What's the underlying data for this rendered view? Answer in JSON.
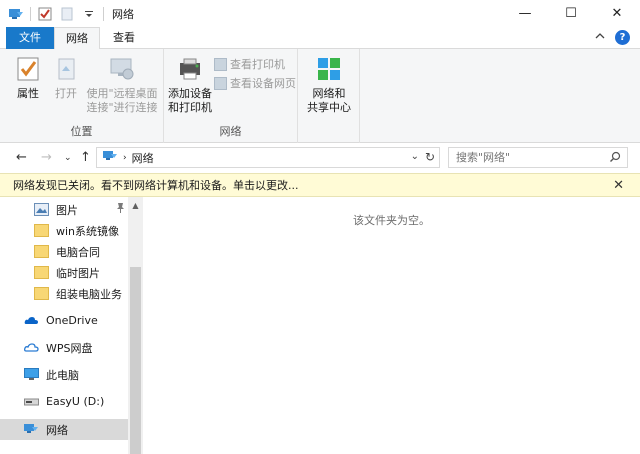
{
  "window": {
    "title": "网络",
    "controls": {
      "minimize": "—",
      "maximize": "☐",
      "close": "✕"
    }
  },
  "tabs": [
    {
      "label": "文件"
    },
    {
      "label": "网络"
    },
    {
      "label": "查看"
    }
  ],
  "ribbon": {
    "groups": [
      {
        "label": "位置",
        "buttons": [
          {
            "label": "属性",
            "enabled": true,
            "icon": "properties-icon"
          },
          {
            "label": "打开",
            "enabled": false,
            "icon": "open-icon"
          },
          {
            "label_line1": "使用\"远程桌面",
            "label_line2": "连接\"进行连接",
            "enabled": false,
            "icon": "remote-desktop-icon"
          }
        ]
      },
      {
        "label": "网络",
        "buttons": [
          {
            "label_line1": "添加设备",
            "label_line2": "和打印机",
            "enabled": true,
            "icon": "add-device-icon"
          },
          {
            "label": "查看打印机",
            "enabled": false,
            "icon": "view-printers-icon"
          },
          {
            "label": "查看设备网页",
            "enabled": false,
            "icon": "view-device-webpage-icon"
          }
        ]
      },
      {
        "label": "",
        "buttons": [
          {
            "label_line1": "网络和",
            "label_line2": "共享中心",
            "enabled": true,
            "icon": "network-sharing-center-icon"
          }
        ]
      }
    ]
  },
  "address_bar": {
    "breadcrumb": [
      "网络"
    ],
    "search_placeholder": "搜索\"网络\""
  },
  "info_bar": {
    "message": "网络发现已关闭。看不到网络计算机和设备。单击以更改..."
  },
  "nav_pane": {
    "items": [
      {
        "label": "图片",
        "icon": "pictures-icon",
        "pinned": true
      },
      {
        "label": "win系统镜像",
        "icon": "folder-icon"
      },
      {
        "label": "电脑合同",
        "icon": "folder-icon"
      },
      {
        "label": "临时图片",
        "icon": "folder-icon"
      },
      {
        "label": "组装电脑业务",
        "icon": "folder-icon"
      },
      {
        "label": "OneDrive",
        "icon": "onedrive-icon"
      },
      {
        "label": "WPS网盘",
        "icon": "wps-cloud-icon"
      },
      {
        "label": "此电脑",
        "icon": "this-pc-icon"
      },
      {
        "label": "EasyU (D:)",
        "icon": "drive-icon"
      },
      {
        "label": "网络",
        "icon": "network-icon",
        "selected": true
      }
    ]
  },
  "content": {
    "empty_message": "该文件夹为空。"
  },
  "colors": {
    "file_tab": "#1979ca",
    "ribbon_bg": "#f5f6f7",
    "info_bar_bg": "#fffbd6",
    "selected_nav": "#d9d9d9"
  }
}
